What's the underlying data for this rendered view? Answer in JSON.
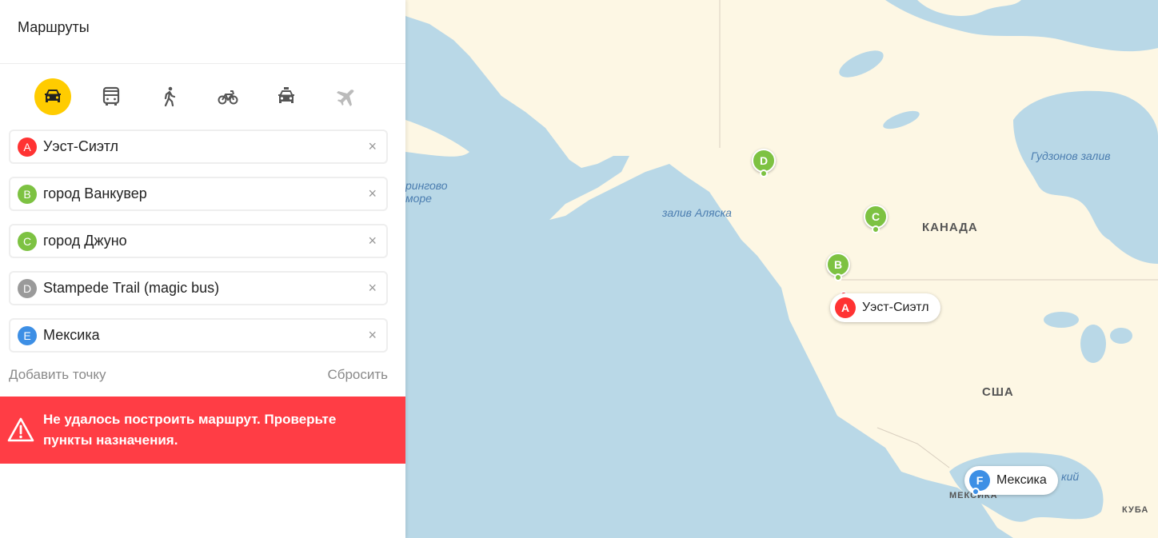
{
  "sidebar": {
    "title": "Маршруты",
    "modes": [
      {
        "name": "car",
        "icon": "car-icon",
        "active": true
      },
      {
        "name": "bus",
        "icon": "bus-icon",
        "active": false
      },
      {
        "name": "walk",
        "icon": "pedestrian-icon",
        "active": false
      },
      {
        "name": "bike",
        "icon": "bicycle-icon",
        "active": false
      },
      {
        "name": "taxi",
        "icon": "taxi-icon",
        "active": false
      },
      {
        "name": "plane",
        "icon": "airplane-icon",
        "active": false
      }
    ],
    "points": [
      {
        "letter": "A",
        "value": "Уэст-Сиэтл",
        "color": "#ff3333"
      },
      {
        "letter": "B",
        "value": "город Ванкувер",
        "color": "#7dc242"
      },
      {
        "letter": "C",
        "value": "город Джуно",
        "color": "#7dc242"
      },
      {
        "letter": "D",
        "value": "Stampede Trail (magic bus)",
        "color": "#9a9a9a"
      },
      {
        "letter": "E",
        "value": "Мексика",
        "color": "#3d8fe5"
      }
    ],
    "clear_symbol": "×",
    "add_point": "Добавить точку",
    "reset": "Сбросить",
    "error": "Не удалось построить маршрут. Проверьте пункты назначения."
  },
  "map": {
    "labels": {
      "bering": "ринговo\nморе",
      "bering_line1": "рингово",
      "bering_line2": "море",
      "gulf_alaska": "залив Аляска",
      "hudson": "Гудзонов залив",
      "canada": "КАНАДА",
      "usa": "США",
      "mexico": "МЕКСИКА",
      "cuba": "КУБА",
      "gulf_partial": "кий"
    },
    "pins": [
      {
        "letter": "D",
        "color": "#7dc242"
      },
      {
        "letter": "C",
        "color": "#7dc242"
      },
      {
        "letter": "B",
        "color": "#7dc242"
      }
    ],
    "callouts": [
      {
        "letter": "A",
        "text": "Уэст-Сиэтл",
        "color": "#ff3333"
      },
      {
        "letter": "F",
        "text": "Мексика",
        "color": "#3d8fe5"
      }
    ],
    "colors": {
      "water": "#b9d8e7",
      "land": "#fdf7e4"
    }
  }
}
